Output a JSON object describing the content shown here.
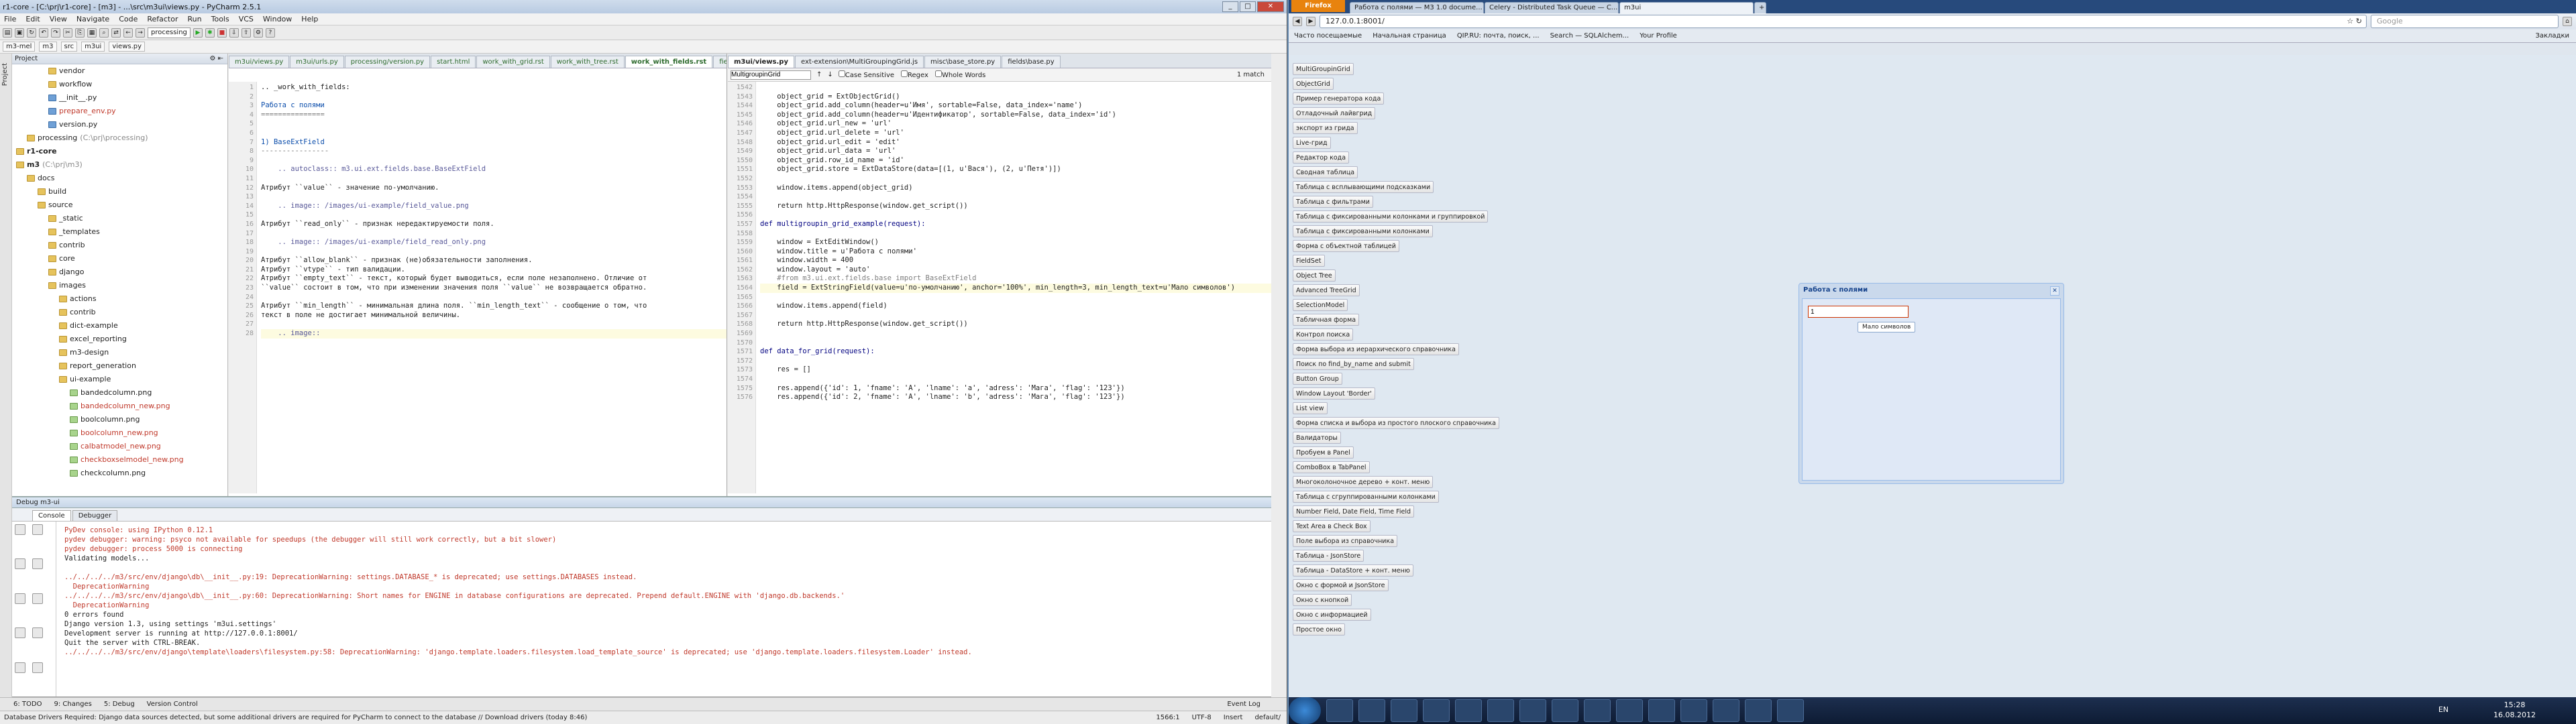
{
  "pycharm": {
    "title": "r1-core - [C:\\prj\\r1-core] - [m3] - ...\\src\\m3ui\\views.py - PyCharm 2.5.1",
    "menu": [
      "File",
      "Edit",
      "View",
      "Navigate",
      "Code",
      "Refactor",
      "Run",
      "Tools",
      "VCS",
      "Window",
      "Help"
    ],
    "run_config": "processing",
    "breadcrumbs": [
      "m3-mel",
      "m3",
      "src",
      "m3ui",
      "views.py"
    ],
    "project_label": "Project",
    "tree": [
      {
        "t": "vendor",
        "k": "folder",
        "d": 3
      },
      {
        "t": "workflow",
        "k": "folder",
        "d": 3
      },
      {
        "t": "__init__.py",
        "k": "py",
        "d": 3
      },
      {
        "t": "prepare_env.py",
        "k": "py",
        "d": 3,
        "c": "red"
      },
      {
        "t": "version.py",
        "k": "py",
        "d": 3
      },
      {
        "t": "processing",
        "k": "folder",
        "d": 1,
        "s": "(C:\\prj\\processing)"
      },
      {
        "t": "r1-core",
        "k": "folder",
        "d": 0,
        "b": true
      },
      {
        "t": "m3",
        "k": "folder",
        "d": 0,
        "b": true,
        "s": "(C:\\prj\\m3)"
      },
      {
        "t": "docs",
        "k": "folder",
        "d": 1
      },
      {
        "t": "build",
        "k": "folder",
        "d": 2
      },
      {
        "t": "source",
        "k": "folder",
        "d": 2
      },
      {
        "t": "_static",
        "k": "folder",
        "d": 3
      },
      {
        "t": "_templates",
        "k": "folder",
        "d": 3
      },
      {
        "t": "contrib",
        "k": "folder",
        "d": 3
      },
      {
        "t": "core",
        "k": "folder",
        "d": 3
      },
      {
        "t": "django",
        "k": "folder",
        "d": 3
      },
      {
        "t": "images",
        "k": "folder",
        "d": 3
      },
      {
        "t": "actions",
        "k": "folder",
        "d": 4
      },
      {
        "t": "contrib",
        "k": "folder",
        "d": 4
      },
      {
        "t": "dict-example",
        "k": "folder",
        "d": 4
      },
      {
        "t": "excel_reporting",
        "k": "folder",
        "d": 4
      },
      {
        "t": "m3-design",
        "k": "folder",
        "d": 4
      },
      {
        "t": "report_generation",
        "k": "folder",
        "d": 4
      },
      {
        "t": "ui-example",
        "k": "folder",
        "d": 4
      },
      {
        "t": "bandedcolumn.png",
        "k": "img",
        "d": 5
      },
      {
        "t": "bandedcolumn_new.png",
        "k": "img",
        "d": 5,
        "c": "red"
      },
      {
        "t": "boolcolumn.png",
        "k": "img",
        "d": 5
      },
      {
        "t": "boolcolumn_new.png",
        "k": "img",
        "d": 5,
        "c": "red"
      },
      {
        "t": "calbatmodel_new.png",
        "k": "img",
        "d": 5,
        "c": "red"
      },
      {
        "t": "checkboxselmodel_new.png",
        "k": "img",
        "d": 5,
        "c": "red"
      },
      {
        "t": "checkcolumn.png",
        "k": "img",
        "d": 5
      }
    ],
    "editor1": {
      "tabs": [
        "m3ui/views.py",
        "m3ui/urls.py",
        "processing/version.py",
        "start.html",
        "work_with_grid.rst",
        "work_with_tree.rst",
        "work_with_fields.rst",
        "fields/complex.py"
      ],
      "active_tab": "work_with_fields.rst",
      "first_line": 1,
      "lines": [
        ".. _work_with_fields:",
        "",
        "Работа с полями",
        "===============",
        "",
        "",
        "1) BaseExtField",
        "----------------",
        "",
        "    .. autoclass:: m3.ui.ext.fields.base.BaseExtField",
        "",
        "Атрибут ``value`` - значение по-умолчанию.",
        "",
        "    .. image:: /images/ui-example/field_value.png",
        "",
        "Атрибут ``read_only`` - признак нередактируемости поля.",
        "",
        "    .. image:: /images/ui-example/field_read_only.png",
        "",
        "Атрибут ``allow_blank`` - признак (не)обязательности заполнения.",
        "Атрибут ``vtype`` - тип валидации.",
        "Атрибут ``empty_text`` - текст, который будет выводиться, если поле незаполнено. Отличие от",
        "``value`` состоит в том, что при изменении значения поля ``value`` не возвращается обратно.",
        "",
        "Атрибут ``min_length`` - минимальная длина поля. ``min_length_text`` - сообщение о том, что",
        "текст в поле не достигает минимальной величины.",
        "",
        "    .. image::"
      ]
    },
    "editor2": {
      "tabs": [
        "m3ui/views.py",
        "ext-extension\\MultiGroupingGrid.js",
        "misc\\base_store.py",
        "fields\\base.py"
      ],
      "active_tab": "m3ui/views.py",
      "find_value": "MultigroupinGrid",
      "find_opts": [
        "Case Sensitive",
        "Regex",
        "Whole Words"
      ],
      "find_result": "1 match",
      "first_line": 1542,
      "lines": [
        "",
        "    object_grid = ExtObjectGrid()",
        "    object_grid.add_column(header=u'Имя', sortable=False, data_index='name')",
        "    object_grid.add_column(header=u'Идентификатор', sortable=False, data_index='id')",
        "    object_grid.url_new = 'url'",
        "    object_grid.url_delete = 'url'",
        "    object_grid.url_edit = 'edit'",
        "    object_grid.url_data = 'url'",
        "    object_grid.row_id_name = 'id'",
        "    object_grid.store = ExtDataStore(data=[(1, u'Вася'), (2, u'Петя')])",
        "",
        "    window.items.append(object_grid)",
        "",
        "    return http.HttpResponse(window.get_script())",
        "",
        "def multigroupin_grid_example(request):",
        "",
        "    window = ExtEditWindow()",
        "    window.title = u'Работа с полями'",
        "    window.width = 400",
        "    window.layout = 'auto'",
        "    #from m3.ui.ext.fields.base import BaseExtField",
        "    field = ExtStringField(value=u'по-умолчанию', anchor='100%', min_length=3, min_length_text=u'Мало символов')",
        "",
        "    window.items.append(field)",
        "",
        "    return http.HttpResponse(window.get_script())",
        "",
        "",
        "def data_for_grid(request):",
        "",
        "    res = []",
        "",
        "    res.append({'id': 1, 'fname': 'A', 'lname': 'a', 'adress': 'Мага', 'flag': '123'})",
        "    res.append({'id': 2, 'fname': 'A', 'lname': 'b', 'adress': 'Мага', 'flag': '123'})"
      ]
    },
    "debug": {
      "header": "Debug  m3-ui",
      "tabs": [
        "Console",
        "Debugger"
      ],
      "lines": [
        {
          "t": "PyDev console: using IPython 0.12.1",
          "e": true
        },
        {
          "t": "pydev debugger: warning: psyco not available for speedups (the debugger will still work correctly, but a bit slower)",
          "e": true
        },
        {
          "t": "pydev debugger: process 5000 is connecting",
          "e": true
        },
        {
          "t": "Validating models...",
          "e": false
        },
        {
          "t": "",
          "e": false
        },
        {
          "t": "../../../../m3/src/env/django\\db\\__init__.py:19: DeprecationWarning: settings.DATABASE_* is deprecated; use settings.DATABASES instead.",
          "e": true
        },
        {
          "t": "  DeprecationWarning",
          "e": true
        },
        {
          "t": "../../../../m3/src/env/django\\db\\__init__.py:60: DeprecationWarning: Short names for ENGINE in database configurations are deprecated. Prepend default.ENGINE with 'django.db.backends.'",
          "e": true
        },
        {
          "t": "  DeprecationWarning",
          "e": true
        },
        {
          "t": "0 errors found",
          "e": false
        },
        {
          "t": "Django version 1.3, using settings 'm3ui.settings'",
          "e": false
        },
        {
          "t": "Development server is running at http://127.0.0.1:8001/",
          "e": false
        },
        {
          "t": "Quit the server with CTRL-BREAK.",
          "e": false
        },
        {
          "t": "../../../../m3/src/env/django\\template\\loaders\\filesystem.py:58: DeprecationWarning: 'django.template.loaders.filesystem.load_template_source' is deprecated; use 'django.template.loaders.filesystem.Loader' instead.",
          "e": true
        }
      ]
    },
    "bottom_tools": [
      "6: TODO",
      "9: Changes",
      "5: Debug",
      "Version Control"
    ],
    "event_log": "Event Log",
    "status_left": "Database Drivers Required:  Django data sources detected, but some  additional drivers are required for PyCharm  to connect to the database // Download drivers (today 8:46)",
    "status_right": [
      "1566:1",
      "UTF-8",
      "Insert",
      "default/"
    ]
  },
  "firefox": {
    "app_button": "Firefox",
    "tabs": [
      "Работа с полями — M3 1.0 docume...",
      "Celery - Distributed Task Queue — C...",
      "m3ui"
    ],
    "active_tab": "m3ui",
    "url": "127.0.0.1:8001/",
    "search_placeholder": "Google",
    "bookmarks": [
      "Часто посещаемые",
      "Начальная страница",
      "QIP.RU: почта, поиск, ...",
      "Search — SQLAlchem...",
      "Your Profile"
    ],
    "bookmarks_right": "Закладки",
    "demo_buttons": [
      "MultiGroupinGrid",
      "ObjectGrid",
      "Пример генератора кода",
      "Отладочный лайвгрид",
      "экспорт из грида",
      "Live-грид",
      "Редактор кода",
      "Сводная таблица",
      "Таблица с всплывающими подсказками",
      "Таблица с фильтрами",
      "Таблица с фиксированными колонками и группировкой",
      "Таблица с фиксированными колонками",
      "Форма с объектной таблицей",
      "FieldSet",
      "Object Tree",
      "Advanced TreeGrid",
      "SelectionModel",
      "Табличная форма",
      "Контрол поиска",
      "Форма выбора из иерархического справочника",
      "Поиск по find_by_name and submit",
      "Button Group",
      "Window Layout 'Border'",
      "List view",
      "Форма списка и выбора из простого плоского справочника",
      "Валидаторы",
      "Пробуем в Panel",
      "ComboBox в TabPanel",
      "Многоколоночное дерево + конт. меню",
      "Таблица с сгруппированными колонками",
      "Number Field, Date Field, Time Field",
      "Text Area в Check Box",
      "Поле выбора из справочника",
      "Таблица - JsonStore",
      "Таблица - DataStore + конт. меню",
      "Окно с формой и JsonStore",
      "Окно с кнопкой",
      "Окно с информацией",
      "Простое окно"
    ],
    "ext_window": {
      "title": "Работа с полями",
      "field_value": "1",
      "tooltip": "Мало символов"
    }
  },
  "taskbar": {
    "lang": "EN",
    "time": "15:28",
    "date": "16.08.2012"
  }
}
